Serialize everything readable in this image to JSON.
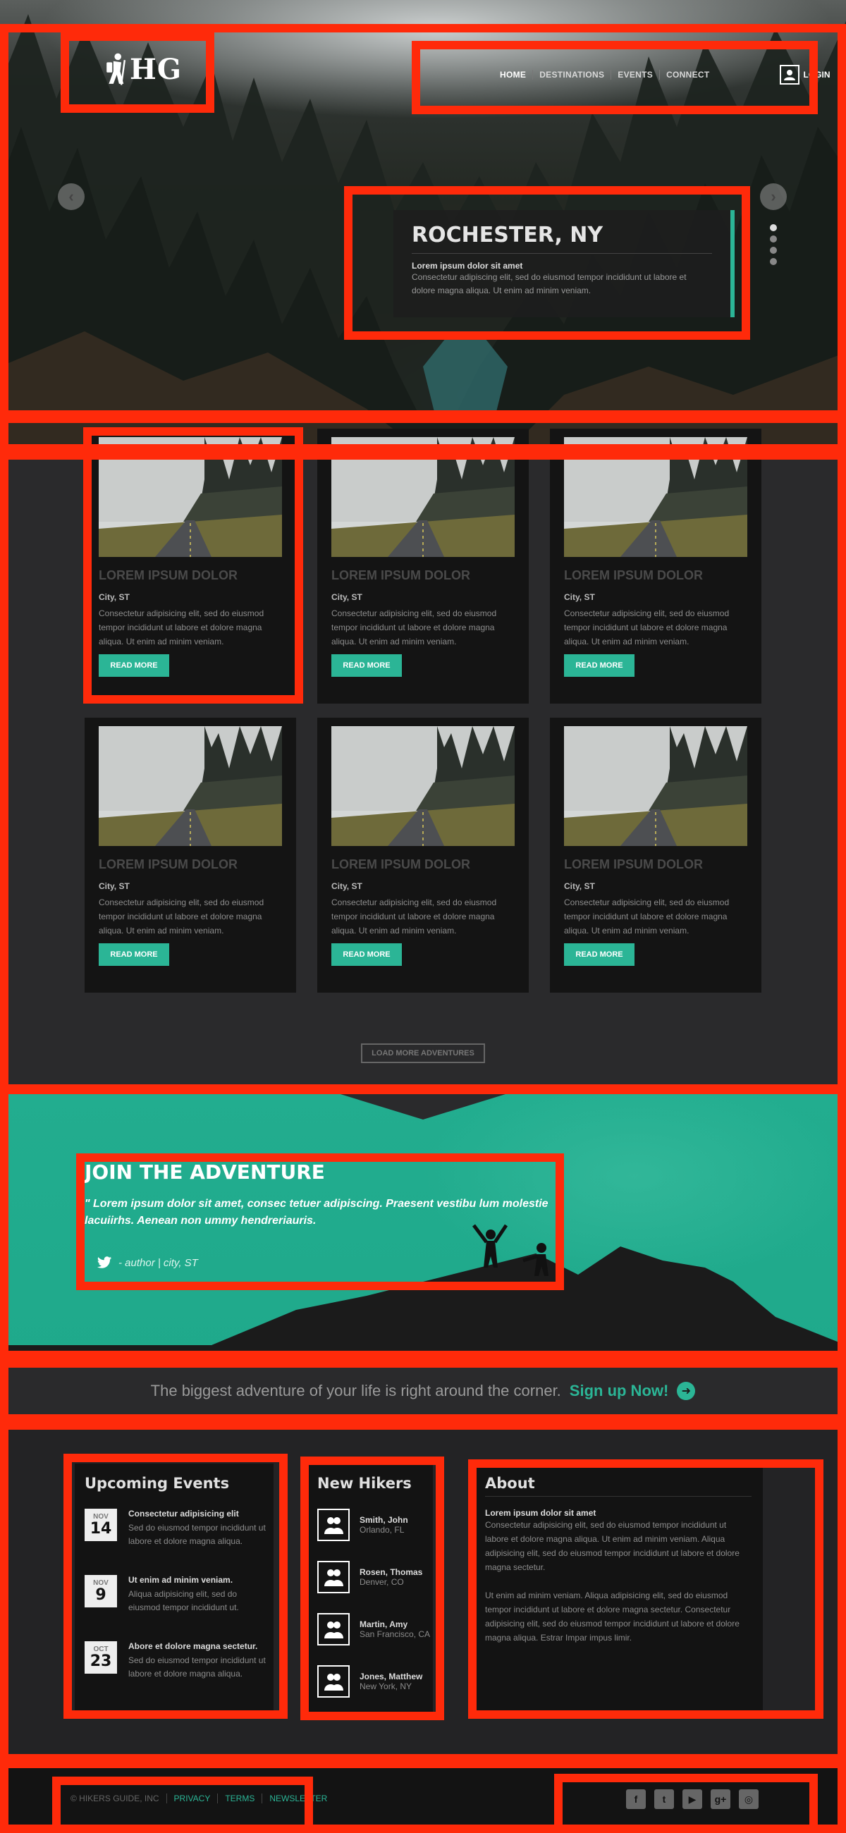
{
  "header": {
    "logo_text": "HG",
    "nav": [
      "HOME",
      "DESTINATIONS",
      "EVENTS",
      "CONNECT"
    ],
    "login_label": "LOGIN"
  },
  "hero": {
    "title": "ROCHESTER, NY",
    "subtitle": "Lorem ipsum dolor sit amet",
    "text": "Consectetur adipiscing elit, sed do eiusmod tempor incididunt ut labore et dolore magna aliqua. Ut enim ad minim veniam.",
    "prev_icon": "chevron-left-icon",
    "next_icon": "chevron-right-icon",
    "slide_count": 4,
    "active_slide": 1
  },
  "cards": [
    {
      "title": "LOREM IPSUM DOLOR",
      "location": "City, ST",
      "text": "Consectetur adipisicing elit, sed do eiusmod tempor incididunt ut labore et dolore magna aliqua. Ut enim ad minim veniam.",
      "button": "READ MORE"
    },
    {
      "title": "LOREM IPSUM DOLOR",
      "location": "City, ST",
      "text": "Consectetur adipisicing elit, sed do eiusmod tempor incididunt ut labore et dolore magna aliqua. Ut enim ad minim veniam.",
      "button": "READ MORE"
    },
    {
      "title": "LOREM IPSUM DOLOR",
      "location": "City, ST",
      "text": "Consectetur adipisicing elit, sed do eiusmod tempor incididunt ut labore et dolore magna aliqua. Ut enim ad minim veniam.",
      "button": "READ MORE"
    },
    {
      "title": "LOREM IPSUM DOLOR",
      "location": "City, ST",
      "text": "Consectetur adipisicing elit, sed do eiusmod tempor incididunt ut labore et dolore magna aliqua. Ut enim ad minim veniam.",
      "button": "READ MORE"
    },
    {
      "title": "LOREM IPSUM DOLOR",
      "location": "City, ST",
      "text": "Consectetur adipisicing elit, sed do eiusmod tempor incididunt ut labore et dolore magna aliqua. Ut enim ad minim veniam.",
      "button": "READ MORE"
    },
    {
      "title": "LOREM IPSUM DOLOR",
      "location": "City, ST",
      "text": "Consectetur adipisicing elit, sed do eiusmod tempor incididunt ut labore et dolore magna aliqua. Ut enim ad minim veniam.",
      "button": "READ MORE"
    }
  ],
  "load_more": "LOAD MORE ADVENTURES",
  "join": {
    "title": "JOIN THE ADVENTURE",
    "quote": "\" Lorem ipsum dolor sit amet, consec tetuer adipiscing. Praesent vestibu lum molestie lacuiirhs. Aenean non ummy hendreriauris.",
    "author": "- author | city, ST",
    "author_icon": "twitter-icon"
  },
  "cta": {
    "text": "The biggest adventure of your life is right around the corner.",
    "link": "Sign up Now!",
    "icon": "arrow-circle-right-icon"
  },
  "events": {
    "title": "Upcoming Events",
    "items": [
      {
        "month": "NOV",
        "day": "14",
        "title": "Consectetur adipisicing elit",
        "text": "Sed do eiusmod tempor incididunt ut labore et dolore magna aliqua."
      },
      {
        "month": "NOV",
        "day": "9",
        "title": "Ut enim ad minim veniam.",
        "text": "Aliqua adipisicing elit, sed do eiusmod tempor incididunt ut."
      },
      {
        "month": "OCT",
        "day": "23",
        "title": "Abore et dolore magna sectetur.",
        "text": "Sed do eiusmod tempor incididunt ut labore et dolore magna aliqua."
      }
    ]
  },
  "hikers": {
    "title": "New Hikers",
    "items": [
      {
        "name": "Smith, John",
        "location": "Orlando, FL"
      },
      {
        "name": "Rosen, Thomas",
        "location": "Denver, CO"
      },
      {
        "name": "Martin, Amy",
        "location": "San Francisco, CA"
      },
      {
        "name": "Jones, Matthew",
        "location": "New York, NY"
      }
    ]
  },
  "about": {
    "title": "About",
    "subtitle": "Lorem ipsum dolor sit amet",
    "p1": "Consectetur adipisicing elit, sed do eiusmod tempor incididunt ut labore et dolore magna aliqua. Ut enim ad minim veniam. Aliqua adipisicing elit, sed do eiusmod tempor incididunt ut labore et dolore magna sectetur.",
    "p2": "Ut enim ad minim veniam. Aliqua adipisicing elit, sed do eiusmod tempor incididunt ut labore et dolore magna sectetur. Consectetur adipisicing elit, sed do eiusmod tempor incididunt ut labore et dolore magna aliqua. Estrar Impar impus limir."
  },
  "footer": {
    "copyright": "© HIKERS GUIDE, INC",
    "links": [
      "PRIVACY",
      "TERMS",
      "NEWSLETTER"
    ],
    "social_icons": [
      "facebook-icon",
      "twitter-icon",
      "youtube-icon",
      "google-plus-icon",
      "instagram-icon"
    ]
  },
  "colors": {
    "accent": "#2bb596",
    "annotation": "#ff2a0a",
    "dark_bg": "#1b1b1b"
  }
}
